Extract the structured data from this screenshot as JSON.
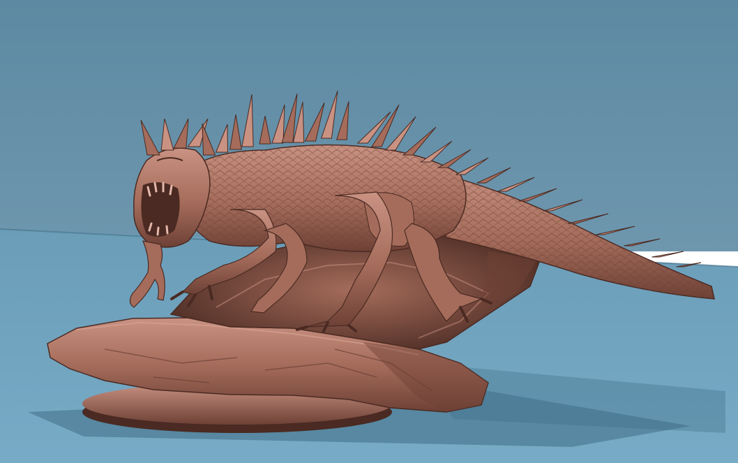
{
  "scene": {
    "subject": "spiked-lizard-sculpt-on-rock-base",
    "colors": {
      "backdrop_top": "#5d89a2",
      "backdrop_bottom": "#6e97ae",
      "floor_near": "#77abc6",
      "floor_far": "#6b9db8",
      "clay_light": "#c99282",
      "clay_mid": "#a56c5b",
      "clay_dark": "#6e4136",
      "clay_deep": "#4a2a22",
      "shadow": "#3f6d86"
    }
  }
}
